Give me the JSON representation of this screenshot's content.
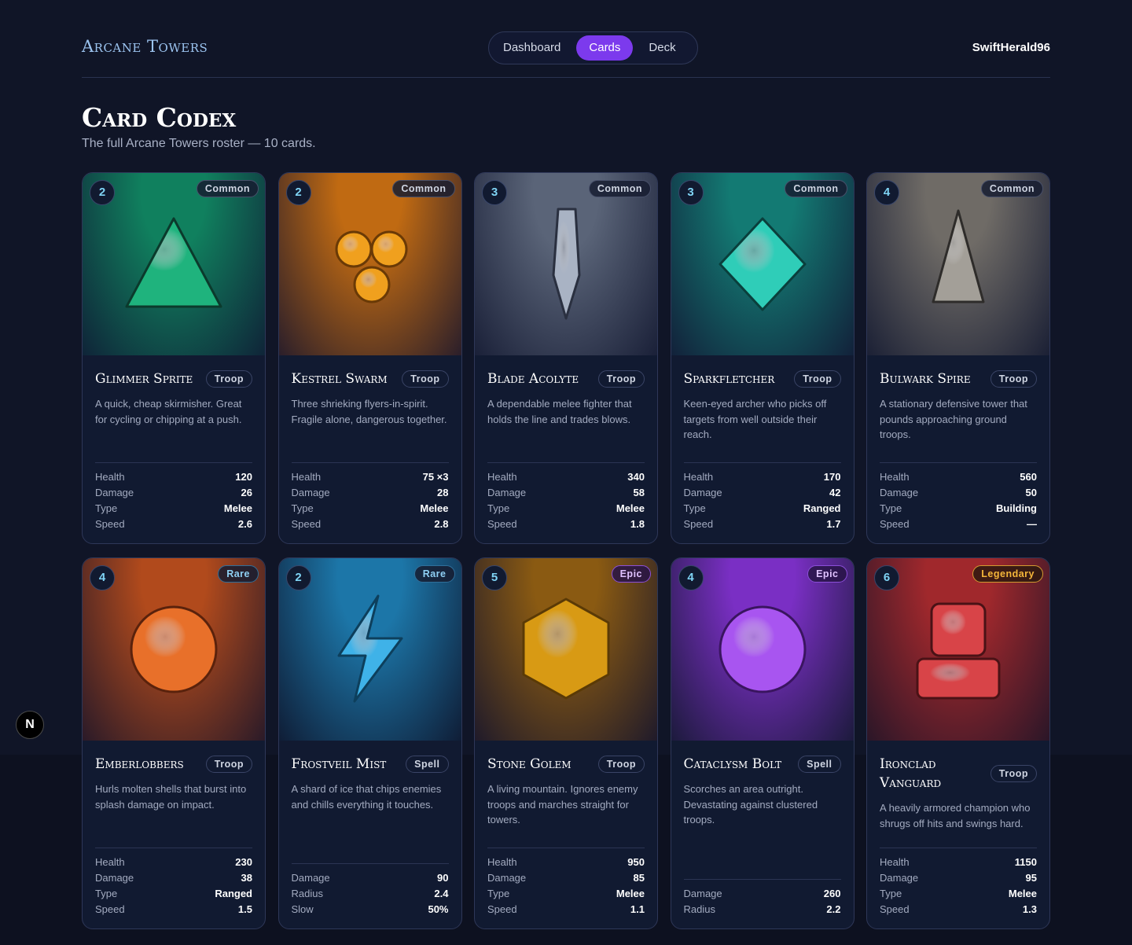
{
  "app": {
    "brand": "Arcane Towers",
    "user": "SwiftHerald96"
  },
  "nav": [
    {
      "label": "Dashboard",
      "active": false
    },
    {
      "label": "Cards",
      "active": true
    },
    {
      "label": "Deck",
      "active": false
    }
  ],
  "page": {
    "title": "Card Codex",
    "subtitle": "The full Arcane Towers roster — 10 cards."
  },
  "cards": [
    {
      "name": "Glimmer Sprite",
      "cost": "2",
      "rarity": "Common",
      "kind": "Troop",
      "desc": "A quick, cheap skirmisher. Great for cycling or chipping at a push.",
      "shape": "triangle",
      "art_top": "#10805e",
      "art_bottom": "#0f2438",
      "shape_color": "#1fb37d",
      "stats": [
        {
          "label": "Health",
          "value": "120"
        },
        {
          "label": "Damage",
          "value": "26"
        },
        {
          "label": "Type",
          "value": "Melee"
        },
        {
          "label": "Speed",
          "value": "2.6"
        }
      ]
    },
    {
      "name": "Kestrel Swarm",
      "cost": "2",
      "rarity": "Common",
      "kind": "Troop",
      "desc": "Three shrieking flyers-in-spirit. Fragile alone, dangerous together.",
      "shape": "three-orbs",
      "art_top": "#c06a12",
      "art_bottom": "#2a1e2a",
      "shape_color": "#f0a01e",
      "stats": [
        {
          "label": "Health",
          "value": "75 ×3"
        },
        {
          "label": "Damage",
          "value": "28"
        },
        {
          "label": "Type",
          "value": "Melee"
        },
        {
          "label": "Speed",
          "value": "2.8"
        }
      ]
    },
    {
      "name": "Blade Acolyte",
      "cost": "3",
      "rarity": "Common",
      "kind": "Troop",
      "desc": "A dependable melee fighter that holds the line and trades blows.",
      "shape": "blade",
      "art_top": "#5a6478",
      "art_bottom": "#1a2038",
      "shape_color": "#a9b3c4",
      "stats": [
        {
          "label": "Health",
          "value": "340"
        },
        {
          "label": "Damage",
          "value": "58"
        },
        {
          "label": "Type",
          "value": "Melee"
        },
        {
          "label": "Speed",
          "value": "1.8"
        }
      ]
    },
    {
      "name": "Sparkfletcher",
      "cost": "3",
      "rarity": "Common",
      "kind": "Troop",
      "desc": "Keen-eyed archer who picks off targets from well outside their reach.",
      "shape": "diamond",
      "art_top": "#137a73",
      "art_bottom": "#12213a",
      "shape_color": "#2fcdb8",
      "stats": [
        {
          "label": "Health",
          "value": "170"
        },
        {
          "label": "Damage",
          "value": "42"
        },
        {
          "label": "Type",
          "value": "Ranged"
        },
        {
          "label": "Speed",
          "value": "1.7"
        }
      ]
    },
    {
      "name": "Bulwark Spire",
      "cost": "4",
      "rarity": "Common",
      "kind": "Troop",
      "desc": "A stationary defensive tower that pounds approaching ground troops.",
      "shape": "spire",
      "art_top": "#6f6b66",
      "art_bottom": "#1b2035",
      "shape_color": "#a39f98",
      "stats": [
        {
          "label": "Health",
          "value": "560"
        },
        {
          "label": "Damage",
          "value": "50"
        },
        {
          "label": "Type",
          "value": "Building"
        },
        {
          "label": "Speed",
          "value": "—"
        }
      ]
    },
    {
      "name": "Emberlobbers",
      "cost": "4",
      "rarity": "Rare",
      "kind": "Troop",
      "desc": "Hurls molten shells that burst into splash damage on impact.",
      "shape": "orb",
      "art_top": "#b14a1c",
      "art_bottom": "#2a1a28",
      "shape_color": "#e8702a",
      "stats": [
        {
          "label": "Health",
          "value": "230"
        },
        {
          "label": "Damage",
          "value": "38"
        },
        {
          "label": "Type",
          "value": "Ranged"
        },
        {
          "label": "Speed",
          "value": "1.5"
        }
      ]
    },
    {
      "name": "Frostveil Mist",
      "cost": "2",
      "rarity": "Rare",
      "kind": "Spell",
      "desc": "A shard of ice that chips enemies and chills everything it touches.",
      "shape": "bolt",
      "art_top": "#1c76a8",
      "art_bottom": "#0f1d36",
      "shape_color": "#3fb2e8",
      "stats": [
        {
          "label": "Damage",
          "value": "90"
        },
        {
          "label": "Radius",
          "value": "2.4"
        },
        {
          "label": "Slow",
          "value": "50%"
        }
      ]
    },
    {
      "name": "Stone Golem",
      "cost": "5",
      "rarity": "Epic",
      "kind": "Troop",
      "desc": "A living mountain. Ignores enemy troops and marches straight for towers.",
      "shape": "hexagon",
      "art_top": "#8a5a12",
      "art_bottom": "#1f1a2a",
      "shape_color": "#d89a14",
      "stats": [
        {
          "label": "Health",
          "value": "950"
        },
        {
          "label": "Damage",
          "value": "85"
        },
        {
          "label": "Type",
          "value": "Melee"
        },
        {
          "label": "Speed",
          "value": "1.1"
        }
      ]
    },
    {
      "name": "Cataclysm Bolt",
      "cost": "4",
      "rarity": "Epic",
      "kind": "Spell",
      "desc": "Scorches an area outright. Devastating against clustered troops.",
      "shape": "sphere",
      "art_top": "#7a2fc4",
      "art_bottom": "#1c1a3c",
      "shape_color": "#a855f0",
      "stats": [
        {
          "label": "Damage",
          "value": "260"
        },
        {
          "label": "Radius",
          "value": "2.2"
        }
      ]
    },
    {
      "name": "Ironclad Vanguard",
      "cost": "6",
      "rarity": "Legendary",
      "kind": "Troop",
      "desc": "A heavily armored champion who shrugs off hits and swings hard.",
      "shape": "blocks",
      "art_top": "#a0282c",
      "art_bottom": "#2a1628",
      "shape_color": "#d84448",
      "stats": [
        {
          "label": "Health",
          "value": "1150"
        },
        {
          "label": "Damage",
          "value": "95"
        },
        {
          "label": "Type",
          "value": "Melee"
        },
        {
          "label": "Speed",
          "value": "1.3"
        }
      ]
    }
  ],
  "dev_badge": {
    "label": "N"
  }
}
